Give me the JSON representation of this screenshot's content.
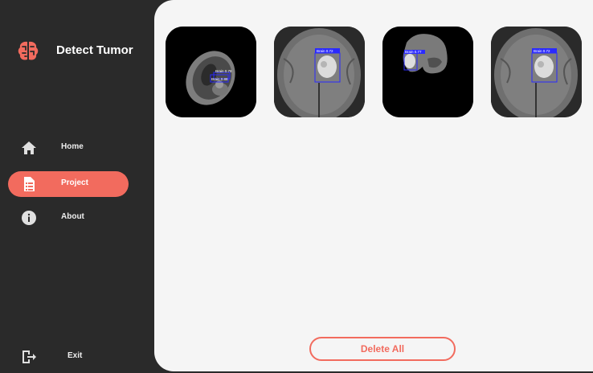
{
  "app": {
    "title": "Detect Tumor",
    "accent_color": "#f26b5e"
  },
  "sidebar": {
    "items": [
      {
        "label": "Home",
        "icon": "home-icon",
        "active": false
      },
      {
        "label": "Project",
        "icon": "document-list-icon",
        "active": true
      },
      {
        "label": "About",
        "icon": "info-icon",
        "active": false
      }
    ],
    "exit": {
      "label": "Exit",
      "icon": "exit-icon"
    }
  },
  "gallery": {
    "images": [
      {
        "detections": [
          "Brain 0.78",
          "Brain 0.88"
        ]
      },
      {
        "detections": [
          "Brain 0.72"
        ]
      },
      {
        "detections": [
          "Brain 0.77"
        ]
      },
      {
        "detections": [
          "Brain 0.72"
        ]
      }
    ]
  },
  "actions": {
    "delete_all_label": "Delete All"
  }
}
